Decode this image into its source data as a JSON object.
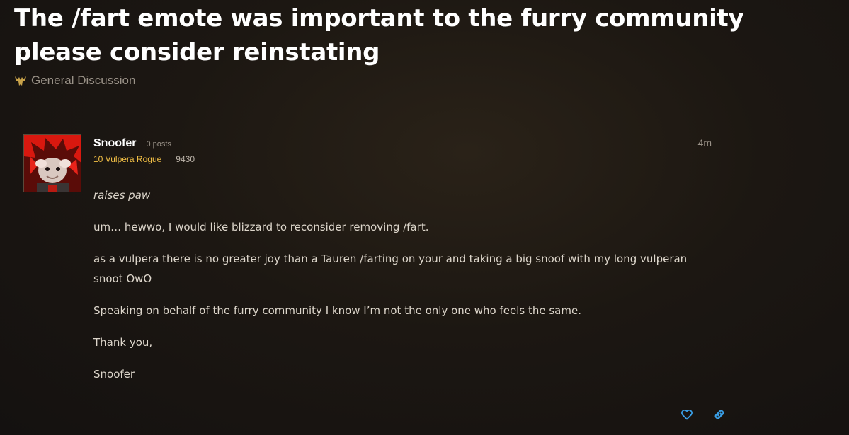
{
  "topic": {
    "title": "The /fart emote was important to the furry community please consider reinstating",
    "category": "General Discussion"
  },
  "post": {
    "author": "Snoofer",
    "post_count": "0 posts",
    "character": "10 Vulpera Rogue",
    "achievement_points": "9430",
    "time_ago": "4m",
    "paragraphs": [
      "raises paw",
      "um… hewwo, I would like blizzard to reconsider removing /fart.",
      "as a vulpera there is no greater joy than a Tauren /farting on your and taking a big snoof with my long vulperan snoot OwO",
      "Speaking on behalf of the furry community I know I’m not the only one who feels the same.",
      "Thank you,",
      "Snoofer"
    ]
  },
  "icons": {
    "category": "horde-icon",
    "like": "heart-icon",
    "share": "link-icon"
  },
  "colors": {
    "class_color": "#f3c046",
    "accent": "#3aa0e8"
  }
}
